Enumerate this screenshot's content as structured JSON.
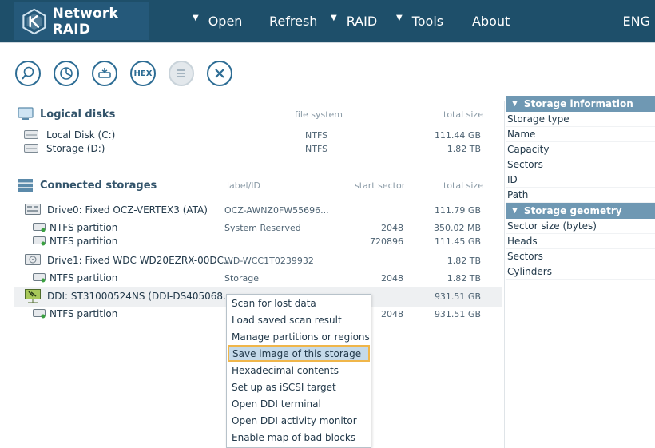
{
  "header": {
    "app_title": "Network RAID",
    "menu": [
      {
        "label": "Open",
        "caret": "▼"
      },
      {
        "label": "Refresh",
        "caret": ""
      },
      {
        "label": "RAID",
        "caret": "▼"
      },
      {
        "label": "Tools",
        "caret": "▼"
      },
      {
        "label": "About",
        "caret": ""
      }
    ],
    "lang": "ENG"
  },
  "toolbar": {
    "buttons": [
      {
        "name": "scan-button",
        "icon": "magnifier-icon"
      },
      {
        "name": "partition-button",
        "icon": "pie-chart-icon"
      },
      {
        "name": "image-button",
        "icon": "disk-image-icon"
      },
      {
        "name": "hex-button",
        "label": "HEX"
      },
      {
        "name": "list-button",
        "icon": "list-icon"
      },
      {
        "name": "close-button",
        "icon": "close-icon"
      }
    ]
  },
  "logical_disks": {
    "title": "Logical disks",
    "col_fs": "file system",
    "col_size": "total size",
    "rows": [
      {
        "name": "Local Disk (C:)",
        "fs": "NTFS",
        "size": "111.44 GB"
      },
      {
        "name": "Storage (D:)",
        "fs": "NTFS",
        "size": "1.82 TB"
      }
    ]
  },
  "connected": {
    "title": "Connected storages",
    "col_label": "label/ID",
    "col_start": "start sector",
    "col_size": "total size",
    "rows": [
      {
        "name": "Drive0: Fixed OCZ-VERTEX3 (ATA)",
        "label": "OCZ-AWNZ0FW55696...",
        "start": "",
        "size": "111.79 GB",
        "kind": "drive"
      },
      {
        "name": "NTFS partition",
        "label": "System Reserved",
        "start": "2048",
        "size": "350.02 MB",
        "kind": "part"
      },
      {
        "name": "NTFS partition",
        "label": "",
        "start": "720896",
        "size": "111.45 GB",
        "kind": "part"
      },
      {
        "name": "Drive1: Fixed WDC WD20EZRX-00DC...",
        "label": "WD-WCC1T0239932",
        "start": "",
        "size": "1.82 TB",
        "kind": "drive"
      },
      {
        "name": "NTFS partition",
        "label": "Storage",
        "start": "2048",
        "size": "1.82 TB",
        "kind": "part"
      },
      {
        "name": "DDI: ST31000524NS (DDI-DS405068...",
        "label": "",
        "start": "",
        "size": "931.51 GB",
        "kind": "ddi"
      },
      {
        "name": "NTFS partition",
        "label": "",
        "start": "2048",
        "size": "931.51 GB",
        "kind": "part"
      }
    ]
  },
  "panel": {
    "info_title": "Storage information",
    "info_items": [
      "Storage type",
      "Name",
      "Capacity",
      "Sectors",
      "ID",
      "Path"
    ],
    "geom_title": "Storage geometry",
    "geom_items": [
      "Sector size (bytes)",
      "Heads",
      "Sectors",
      "Cylinders"
    ]
  },
  "context_menu": {
    "items": [
      "Scan for lost data",
      "Load saved scan result",
      "Manage partitions or regions",
      "Save image of this storage",
      "Hexadecimal contents",
      "Set up as iSCSI target",
      "Open DDI terminal",
      "Open DDI activity monitor",
      "Enable map of bad blocks"
    ],
    "selected_index": 3
  },
  "colors": {
    "header_bg": "#1e4f6a",
    "accent": "#2c6c94",
    "panel_header": "#6f98b3",
    "selection_border": "#f0b64a"
  }
}
